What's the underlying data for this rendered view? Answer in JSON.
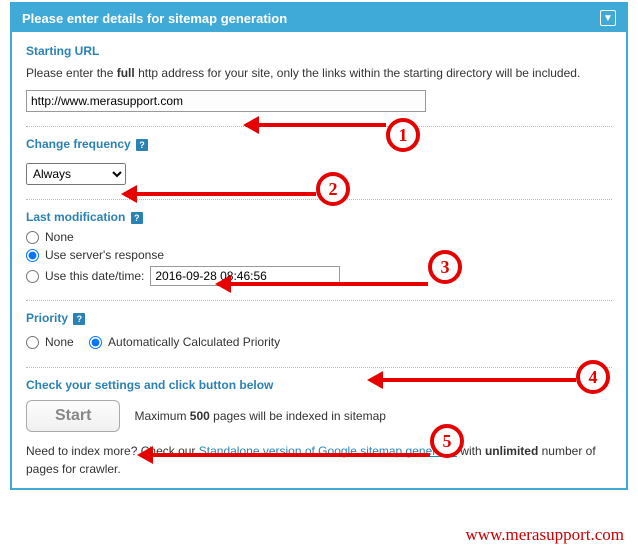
{
  "header": {
    "title": "Please enter details for sitemap generation"
  },
  "startingUrl": {
    "title": "Starting URL",
    "desc_before": "Please enter the ",
    "desc_bold": "full",
    "desc_after": " http address for your site, only the links within the starting directory will be included.",
    "value": "http://www.merasupport.com"
  },
  "changeFreq": {
    "title": "Change frequency",
    "selected": "Always"
  },
  "lastMod": {
    "title": "Last modification",
    "opt_none": "None",
    "opt_server": "Use server's response",
    "opt_date": "Use this date/time:",
    "date_value": "2016-09-28 08:46:56"
  },
  "priority": {
    "title": "Priority",
    "opt_none": "None",
    "opt_auto": "Automatically Calculated Priority"
  },
  "submit": {
    "title": "Check your settings and click button below",
    "button": "Start",
    "note_before": "Maximum ",
    "note_bold": "500",
    "note_after": " pages will be indexed in sitemap"
  },
  "footer": {
    "before": "Need to index more? Check our ",
    "link": "Standalone version of Google sitemap generator",
    "mid": " with ",
    "bold": "unlimited",
    "after": " number of pages for crawler."
  },
  "watermark": "www.merasupport.com",
  "annotations": {
    "n1": "1",
    "n2": "2",
    "n3": "3",
    "n4": "4",
    "n5": "5"
  }
}
